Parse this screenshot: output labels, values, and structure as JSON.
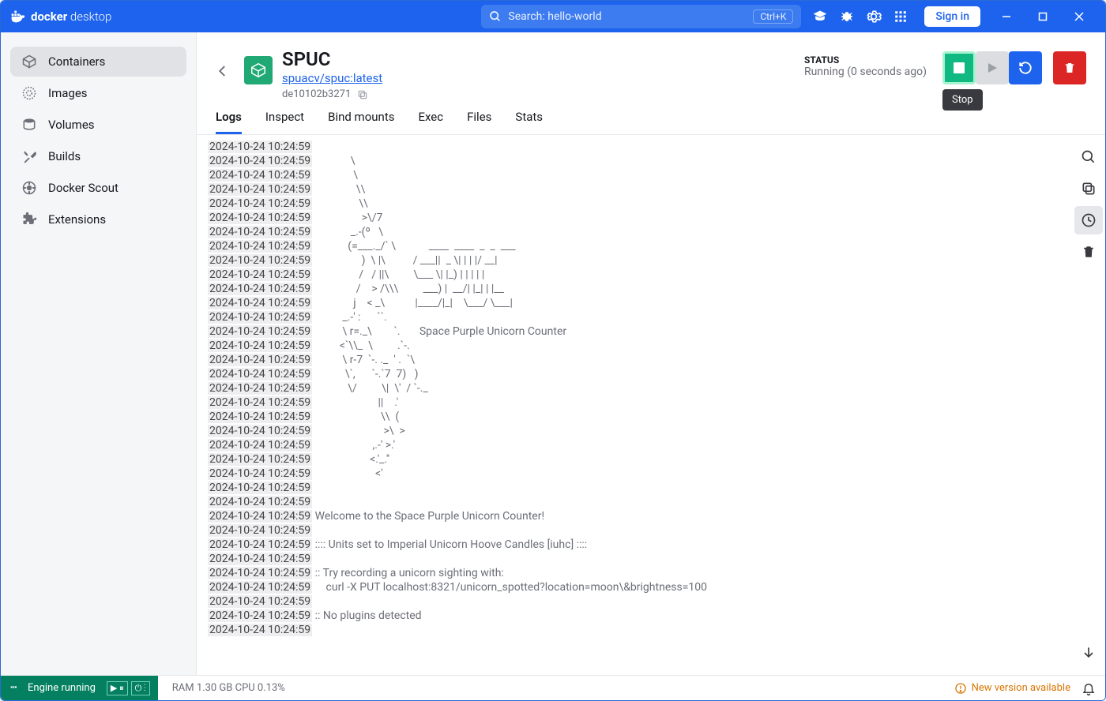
{
  "titlebar": {
    "app_name_bold": "docker",
    "app_name_light": "desktop",
    "search_placeholder": "Search: hello-world",
    "shortcut": "Ctrl+K",
    "signin": "Sign in"
  },
  "sidebar": {
    "items": [
      {
        "label": "Containers"
      },
      {
        "label": "Images"
      },
      {
        "label": "Volumes"
      },
      {
        "label": "Builds"
      },
      {
        "label": "Docker Scout"
      },
      {
        "label": "Extensions"
      }
    ]
  },
  "container": {
    "name": "SPUC",
    "image": "spuacv/spuc:latest",
    "id": "de10102b3271",
    "status_label": "STATUS",
    "status_value": "Running (0 seconds ago)",
    "tooltip_stop": "Stop"
  },
  "tabs": [
    "Logs",
    "Inspect",
    "Bind mounts",
    "Exec",
    "Files",
    "Stats"
  ],
  "logs": [
    {
      "ts": "2024-10-24 10:24:59",
      "m": ""
    },
    {
      "ts": "2024-10-24 10:24:59",
      "m": "             \\"
    },
    {
      "ts": "2024-10-24 10:24:59",
      "m": "              \\"
    },
    {
      "ts": "2024-10-24 10:24:59",
      "m": "               \\\\"
    },
    {
      "ts": "2024-10-24 10:24:59",
      "m": "                \\\\"
    },
    {
      "ts": "2024-10-24 10:24:59",
      "m": "                 >\\/7"
    },
    {
      "ts": "2024-10-24 10:24:59",
      "m": "             _.-(º   \\"
    },
    {
      "ts": "2024-10-24 10:24:59",
      "m": "            (=___._/` \\            ____  ____  _  _  ___"
    },
    {
      "ts": "2024-10-24 10:24:59",
      "m": "                 )  \\ |\\          / ___||  _ \\| | | |/ __|"
    },
    {
      "ts": "2024-10-24 10:24:59",
      "m": "                /   / ||\\         \\___ \\| |_) | | | | |"
    },
    {
      "ts": "2024-10-24 10:24:59",
      "m": "               /    > /\\\\\\         ___) |  __/| |_| | |__"
    },
    {
      "ts": "2024-10-24 10:24:59",
      "m": "              j    < _\\           |____/|_|    \\___/ \\___|"
    },
    {
      "ts": "2024-10-24 10:24:59",
      "m": "          _.-' :      ``."
    },
    {
      "ts": "2024-10-24 10:24:59",
      "m": "          \\ r=._\\        `.       Space Purple Unicorn Counter"
    },
    {
      "ts": "2024-10-24 10:24:59",
      "m": "         <`\\\\_  \\         .`-."
    },
    {
      "ts": "2024-10-24 10:24:59",
      "m": "          \\ r-7  `-. ._  ' .  `\\"
    },
    {
      "ts": "2024-10-24 10:24:59",
      "m": "           \\`,      `-.`7  7)   )"
    },
    {
      "ts": "2024-10-24 10:24:59",
      "m": "            \\/         \\|  \\'  / `-._"
    },
    {
      "ts": "2024-10-24 10:24:59",
      "m": "                       ||    .'"
    },
    {
      "ts": "2024-10-24 10:24:59",
      "m": "                        \\\\  ("
    },
    {
      "ts": "2024-10-24 10:24:59",
      "m": "                         >\\  >"
    },
    {
      "ts": "2024-10-24 10:24:59",
      "m": "                     ,.-' >.'"
    },
    {
      "ts": "2024-10-24 10:24:59",
      "m": "                    <.'_.''"
    },
    {
      "ts": "2024-10-24 10:24:59",
      "m": "                      <'"
    },
    {
      "ts": "2024-10-24 10:24:59",
      "m": ""
    },
    {
      "ts": "2024-10-24 10:24:59",
      "m": ""
    },
    {
      "ts": "2024-10-24 10:24:59",
      "m": "Welcome to the Space Purple Unicorn Counter!"
    },
    {
      "ts": "2024-10-24 10:24:59",
      "m": ""
    },
    {
      "ts": "2024-10-24 10:24:59",
      "m": ":::: Units set to Imperial Unicorn Hoove Candles [iuhc] ::::"
    },
    {
      "ts": "2024-10-24 10:24:59",
      "m": ""
    },
    {
      "ts": "2024-10-24 10:24:59",
      "m": ":: Try recording a unicorn sighting with:"
    },
    {
      "ts": "2024-10-24 10:24:59",
      "m": "    curl -X PUT localhost:8321/unicorn_spotted?location=moon\\&brightness=100"
    },
    {
      "ts": "2024-10-24 10:24:59",
      "m": ""
    },
    {
      "ts": "2024-10-24 10:24:59",
      "m": ":: No plugins detected"
    },
    {
      "ts": "2024-10-24 10:24:59",
      "m": ""
    }
  ],
  "statusbar": {
    "engine": "Engine running",
    "stats": "RAM 1.30 GB   CPU 0.13%",
    "new_version": "New version available"
  }
}
